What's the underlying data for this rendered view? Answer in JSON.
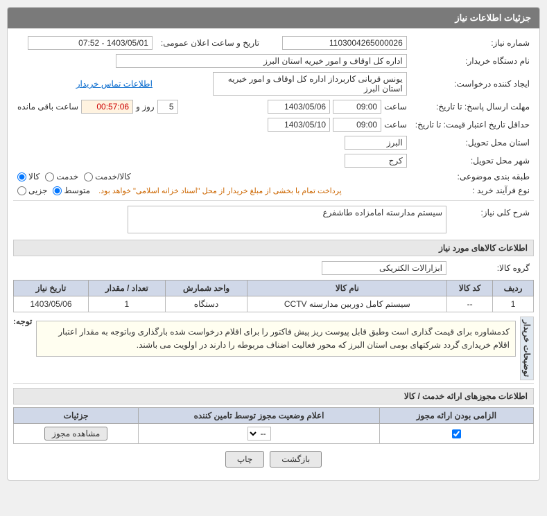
{
  "header": {
    "title": "جزئیات اطلاعات نیاز"
  },
  "fields": {
    "request_number_label": "شماره نیاز:",
    "request_number_value": "1103004265000026",
    "date_label": "تاریخ و ساعت اعلان عمومی:",
    "date_value": "1403/05/01 - 07:52",
    "buyer_name_label": "نام دستگاه خریدار:",
    "buyer_name_value": "اداره کل اوقاف و امور خیریه استان البرز",
    "creator_label": "ایجاد کننده درخواست:",
    "creator_value": "یونس قربانی کاربرداز اداره کل اوقاف و امور خیریه استان البرز",
    "contact_link": "اطلاعات تماس خریدار",
    "response_deadline_label": "مهلت ارسال پاسخ: تا تاریخ:",
    "response_date_value": "1403/05/06",
    "response_time_value": "09:00",
    "response_time_label": "ساعت",
    "response_days_value": "5",
    "response_days_label": "روز و",
    "response_remaining_value": "00:57:06",
    "response_remaining_label": "ساعت باقی مانده",
    "price_deadline_label": "حداقل تاریخ اعتبار قیمت: تا تاریخ:",
    "price_date_value": "1403/05/10",
    "price_time_value": "09:00",
    "price_time_label": "ساعت",
    "province_label": "استان محل تحویل:",
    "province_value": "البرز",
    "city_label": "شهر محل تحویل:",
    "city_value": "کرج",
    "category_label": "طبقه بندی موضوعی:",
    "category_options": [
      "کالا",
      "خدمت",
      "کالا/خدمت"
    ],
    "category_selected": "کالا",
    "process_label": "نوع فرآیند خرید :",
    "process_options": [
      "جزیی",
      "متوسط"
    ],
    "process_selected": "متوسط",
    "process_note": "پرداخت تمام با بخشی از مبلغ خریدار از محل \"اسناد خزانه اسلامی\" خواهد بود.",
    "need_description_label": "شرح کلی نیاز:",
    "need_description_value": "سیستم مدارسته امامزاده طاشفرع",
    "goods_section_title": "اطلاعات کالاهای مورد نیاز",
    "goods_group_label": "گروه کالا:",
    "goods_group_value": "ابزارالات الکتریکی",
    "table_headers": [
      "ردیف",
      "کد کالا",
      "نام کالا",
      "واحد شمارش",
      "تعداد / مقدار",
      "تاریخ نیاز"
    ],
    "table_rows": [
      {
        "row": "1",
        "code": "--",
        "name": "سیستم کامل دوربین مدارسته CCTV",
        "unit": "دستگاه",
        "quantity": "1",
        "date": "1403/05/06"
      }
    ],
    "note_label": "توجه:",
    "note_text": "کدمشاوره برای قیمت گذاری است وطبق قابل پیوست ریز پیش فاکتور را برای اقلام درخواست شده بارگذاری وباتوجه به مقدار اعتبار اقلام خریداری گردد شرکتهای بومی استان البرز که محور فعالیت اضناف مربوطه را دارند در اولویت می باشند.",
    "buyer_notes_label": "توضیحات خریدار",
    "goods_services_section": "اطلاعات مجوزهای ارائه خدمت / کالا",
    "provider_table_headers": [
      "الزامی بودن ارائه مجوز",
      "اعلام وضعیت مجوز توسط تامین کننده",
      "جزئیات"
    ],
    "provider_row": {
      "mandatory_checked": true,
      "status_options": [
        "--"
      ],
      "status_selected": "--",
      "view_button": "مشاهده مجوز"
    },
    "print_button": "چاپ",
    "back_button": "بازگشت"
  }
}
